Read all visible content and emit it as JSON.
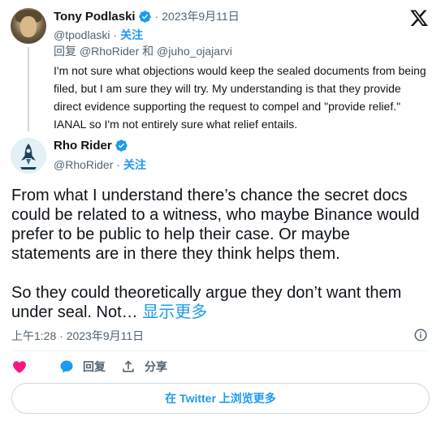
{
  "brand": {
    "logo_icon": "x-logo-icon",
    "accent_color": "#1d9bf0"
  },
  "parent_tweet": {
    "author_name": "Tony Podlaski",
    "handle": "@tpodlaski",
    "date": "2023年9月11日",
    "follow_label": "关注",
    "reply_prefix": "回复",
    "reply_user_1": "@RhoRider",
    "reply_and": "和",
    "reply_user_2": "@juho_ojajarvi",
    "text": "I'm not sure what objections would keep the sealed documents from being filed, but I am sure they will try. My understanding is that they provide direct evidence supporting the request to compel and \"provide relief.\" IANAL so I'm not entirely sure what relief entails."
  },
  "main_tweet": {
    "author_name": "Rho Rider",
    "handle": "@RhoRider",
    "follow_label": "关注",
    "paragraph_1": "From what I understand there’s chance the secret docs could be related to a witness, who maybe Binance would prefer to be public to help their case.  Or maybe statements are in there they think helps them.",
    "paragraph_2": "So they could theoretically argue they don’t want them under seal.  Not…",
    "show_more": "显示更多",
    "timestamp": "上午1:28 · 2023年9月11日"
  },
  "actions": {
    "reply_label": "回复",
    "share_label": "分享",
    "like_color": "#f91880"
  },
  "read_more_label": "在 Twitter 上浏览更多"
}
